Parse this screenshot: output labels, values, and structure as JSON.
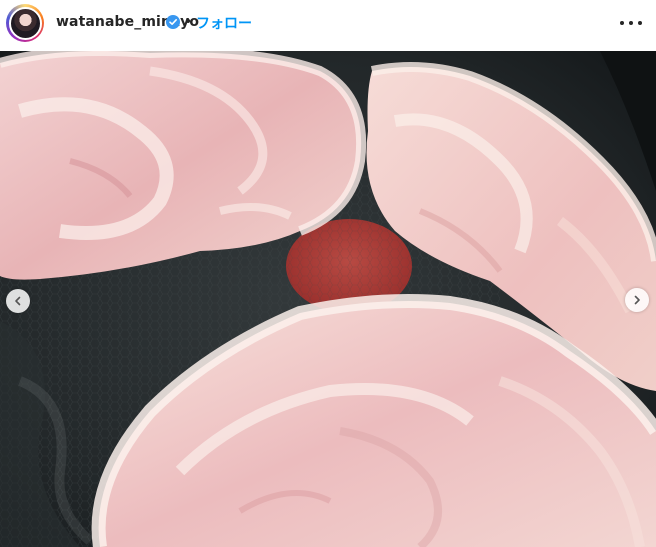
{
  "post": {
    "username": "watanabe_minayo",
    "separator": "•",
    "follow_label": "フォロー"
  },
  "icons": {
    "avatar": "profile-avatar",
    "verified": "verified-badge-icon",
    "more": "more-options-icon",
    "prev": "chevron-left-icon",
    "next": "chevron-right-icon"
  },
  "colors": {
    "follow": "#0095f6",
    "verified": "#3897f0",
    "text": "#262626"
  },
  "photo": {
    "subject": "raw pork steaks in a frying pan"
  }
}
